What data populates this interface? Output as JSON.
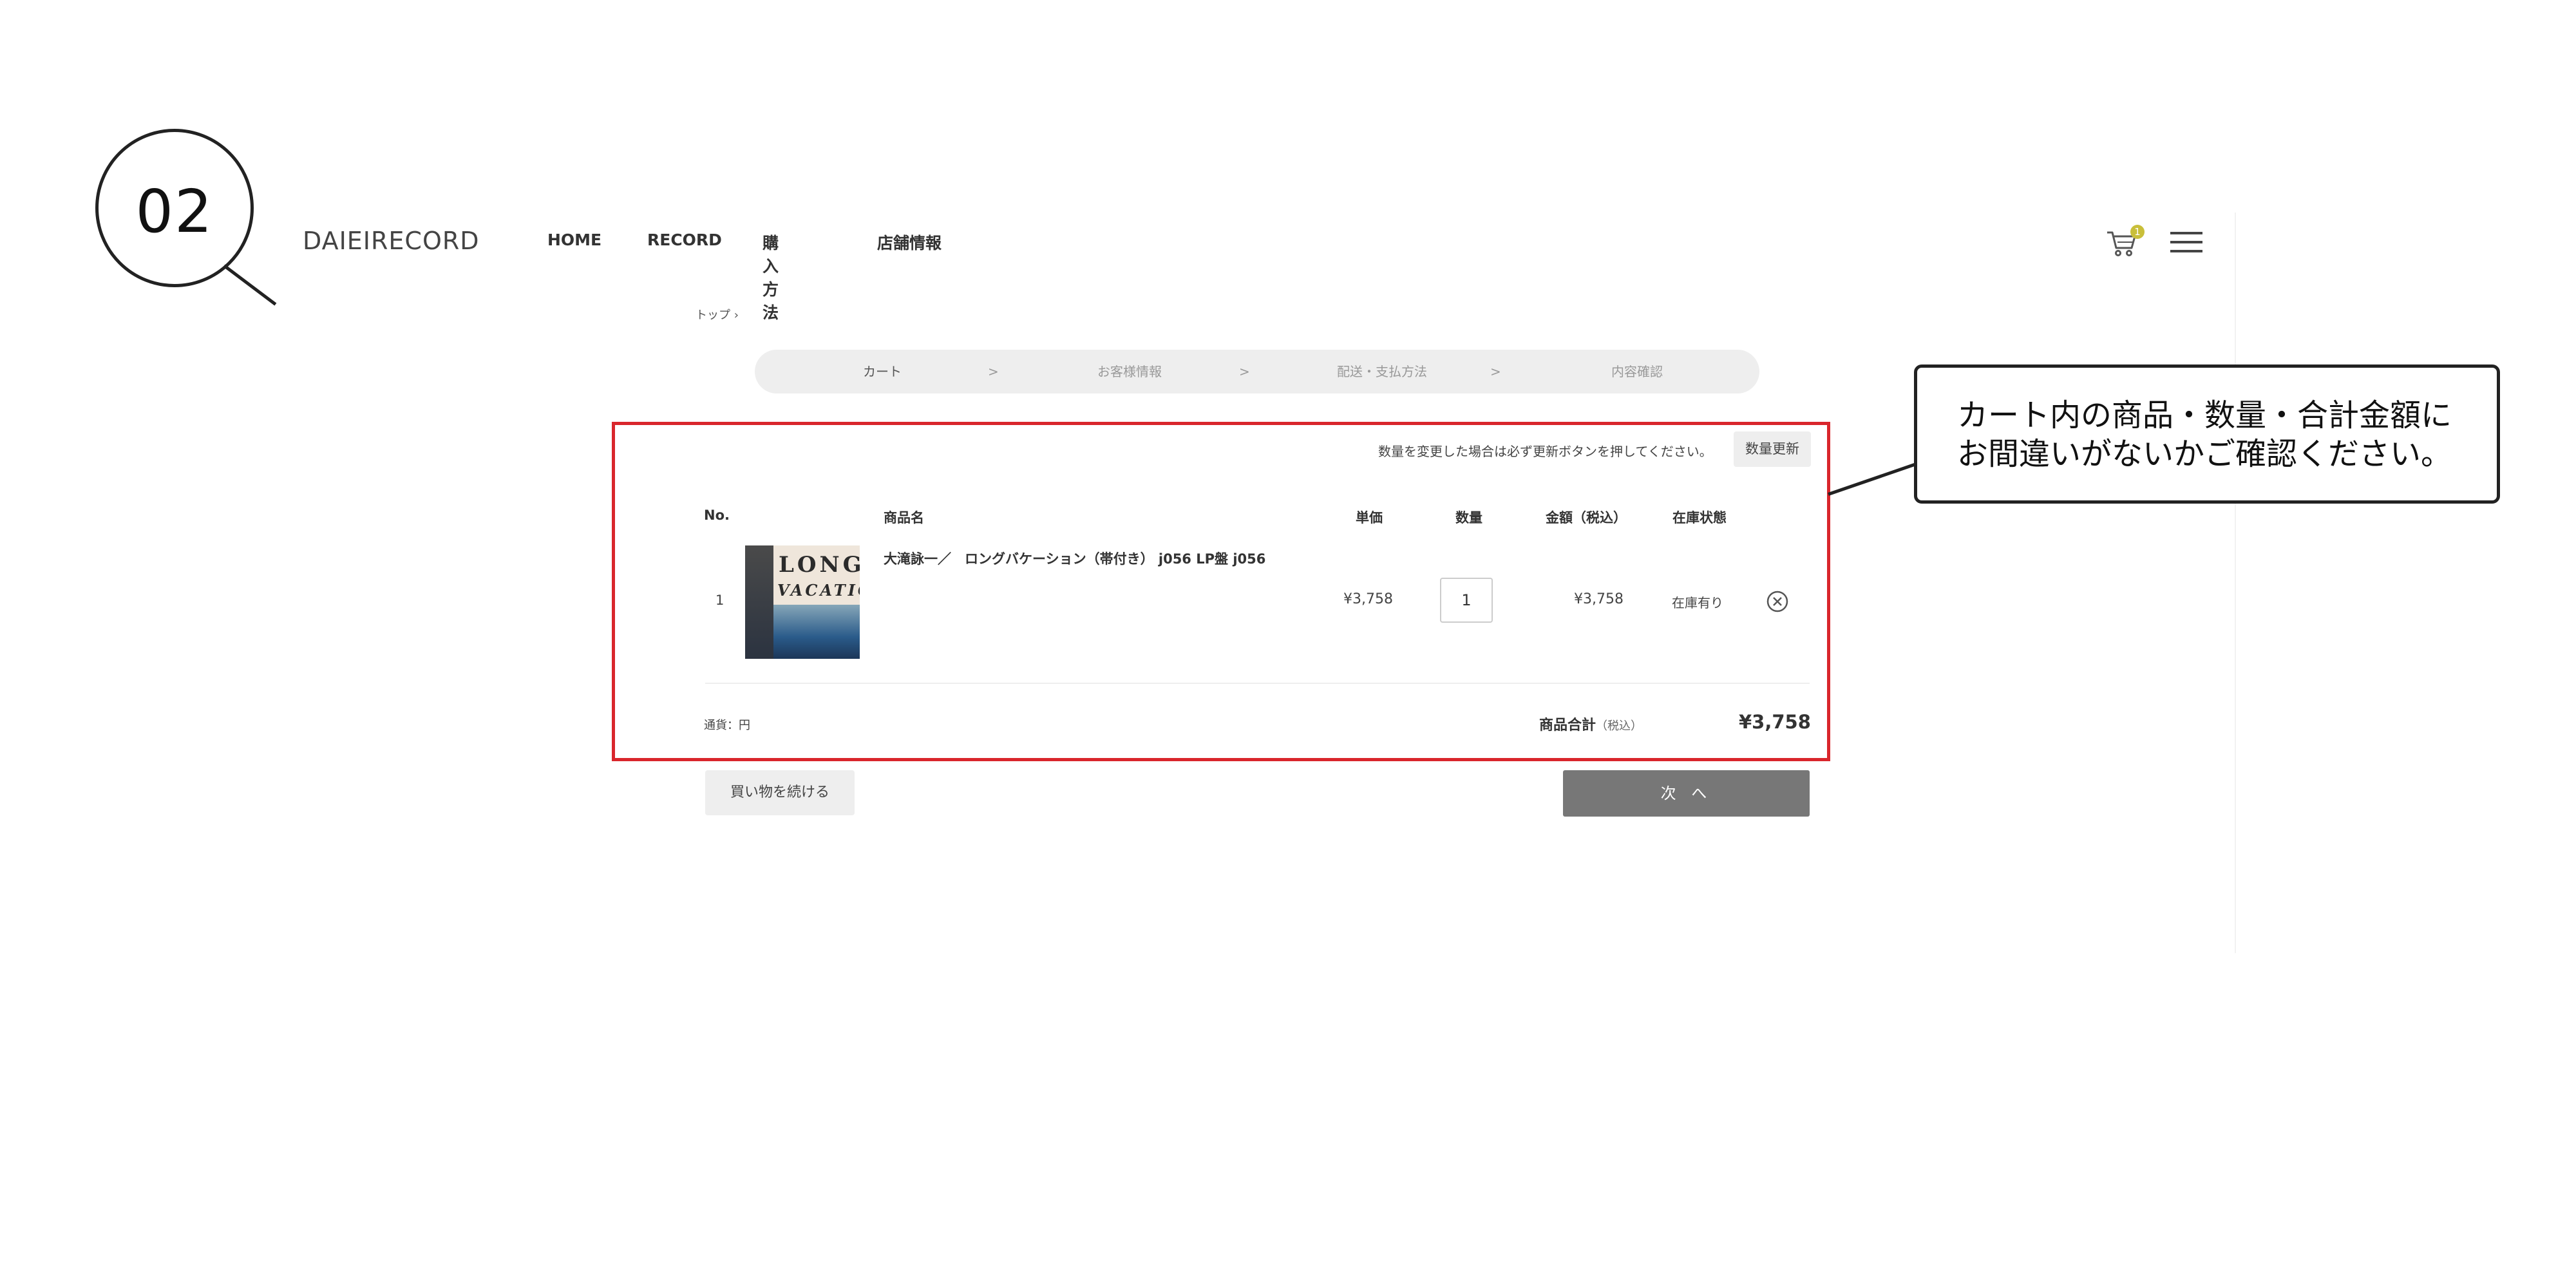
{
  "step_badge": {
    "number": "02"
  },
  "header": {
    "brand": "DAIEIRECORD",
    "nav": [
      "HOME",
      "RECORD",
      "購入方法",
      "店舗情報"
    ],
    "cart_count": "1"
  },
  "breadcrumb": "トップ ›",
  "progress_steps": {
    "steps": [
      "カート",
      "お客様情報",
      "配送・支払方法",
      "内容確認"
    ],
    "separator": ">",
    "active_index": 0
  },
  "cart": {
    "update_note": "数量を変更した場合は必ず更新ボタンを押してください。",
    "update_button": "数量更新",
    "columns": {
      "no": "No.",
      "name": "商品名",
      "price": "単価",
      "qty": "数量",
      "amount": "金額（税込）",
      "stock": "在庫状態"
    },
    "items": [
      {
        "no": "1",
        "cover_line1": "LONG",
        "cover_line2": "VACATION",
        "name": "大滝詠一／　ロングバケーション（帯付き） j056 LP盤 j056",
        "price": "¥3,758",
        "qty": "1",
        "amount": "¥3,758",
        "stock": "在庫有り"
      }
    ],
    "currency": "通貨：円",
    "subtotal_label": "商品合計",
    "subtotal_tax": "（税込）",
    "subtotal_value": "¥3,758",
    "continue_button": "買い物を続ける",
    "next_button": "次 へ"
  },
  "callout": {
    "line1": "カート内の商品・数量・合計金額に",
    "line2": "お間違いがないかご確認ください。"
  },
  "colors": {
    "highlight": "#d9262c",
    "next_button_bg": "#777777",
    "cart_badge": "#c9bf3a"
  }
}
